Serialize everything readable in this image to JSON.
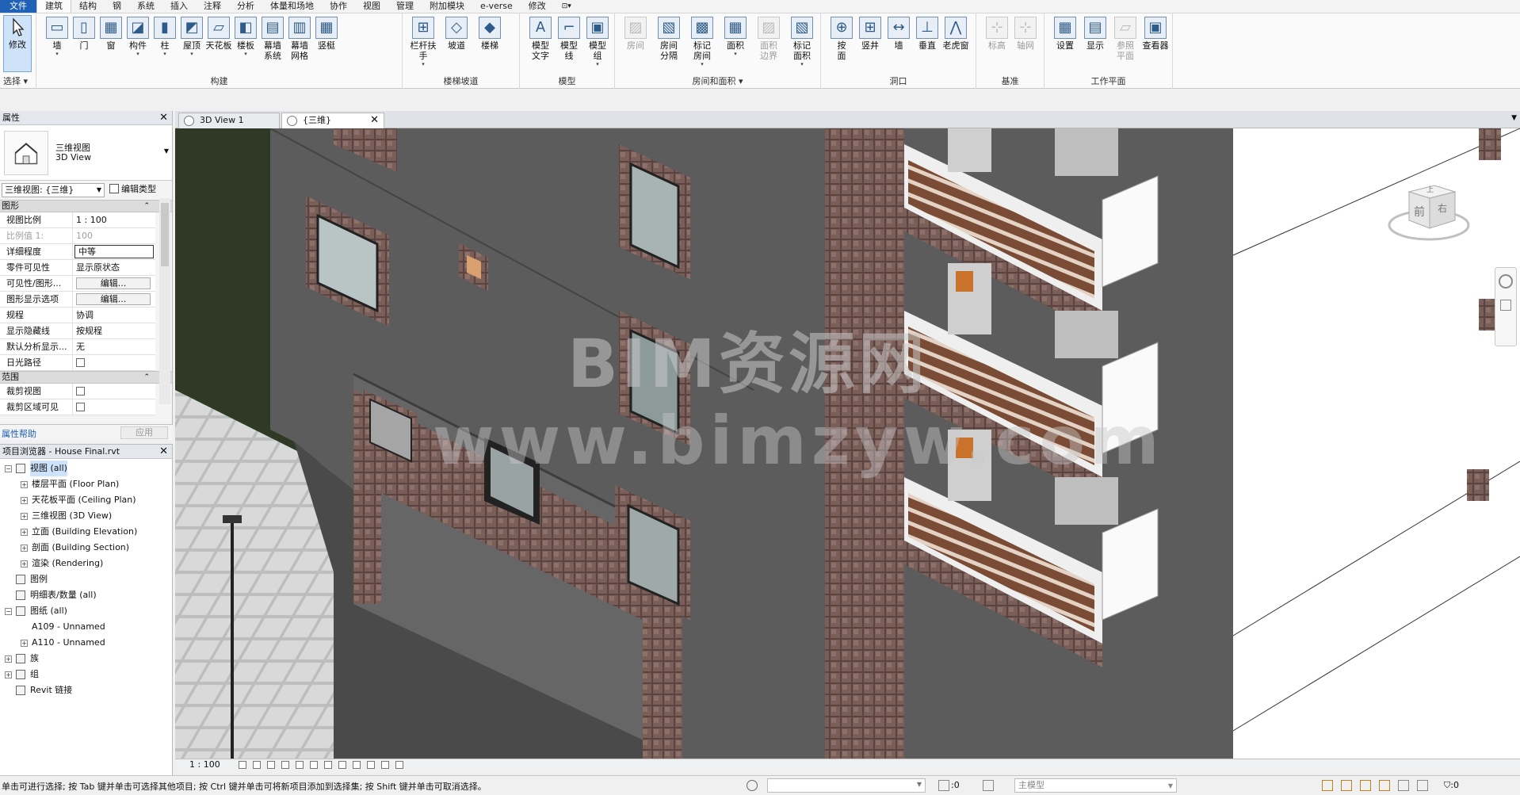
{
  "menu": {
    "tabs": [
      "文件",
      "建筑",
      "结构",
      "钢",
      "系统",
      "插入",
      "注释",
      "分析",
      "体量和场地",
      "协作",
      "视图",
      "管理",
      "附加模块",
      "e-verse",
      "修改"
    ],
    "active_index": 1
  },
  "ribbon": {
    "select": {
      "label": "修改",
      "title": "选择 ▾"
    },
    "build": {
      "title": "构建",
      "tools": [
        {
          "label": "墙",
          "dd": true
        },
        {
          "label": "门",
          "dd": false
        },
        {
          "label": "窗",
          "dd": false
        },
        {
          "label": "构件",
          "dd": true
        },
        {
          "label": "柱",
          "dd": true
        },
        {
          "label": "屋顶",
          "dd": true
        },
        {
          "label": "天花板",
          "dd": false
        },
        {
          "label": "楼板",
          "dd": true
        },
        {
          "label": "幕墙\n系统",
          "dd": false
        },
        {
          "label": "幕墙\n网格",
          "dd": false
        },
        {
          "label": "竖梃",
          "dd": false
        }
      ]
    },
    "stairs": {
      "title": "楼梯坡道",
      "tools": [
        {
          "label": "栏杆扶手",
          "dd": true
        },
        {
          "label": "坡道",
          "dd": false
        },
        {
          "label": "楼梯",
          "dd": false
        }
      ]
    },
    "model": {
      "title": "模型",
      "tools": [
        {
          "label": "模型\n文字",
          "dd": false
        },
        {
          "label": "模型\n线",
          "dd": false
        },
        {
          "label": "模型\n组",
          "dd": true
        }
      ]
    },
    "room": {
      "title": "房间和面积 ▾",
      "tools": [
        {
          "label": "房间",
          "dd": false,
          "dim": true
        },
        {
          "label": "房间\n分隔",
          "dd": false
        },
        {
          "label": "标记\n房间",
          "dd": true
        },
        {
          "label": "面积",
          "dd": true
        },
        {
          "label": "面积\n边界",
          "dd": false,
          "dim": true
        },
        {
          "label": "标记\n面积",
          "dd": true
        }
      ]
    },
    "opening": {
      "title": "洞口",
      "tools": [
        {
          "label": "按\n面",
          "dd": false
        },
        {
          "label": "竖井",
          "dd": false
        },
        {
          "label": "墙",
          "dd": false
        },
        {
          "label": "垂直",
          "dd": false
        },
        {
          "label": "老虎窗",
          "dd": false
        }
      ]
    },
    "datum": {
      "title": "基准",
      "tools": [
        {
          "label": "标高",
          "dd": false,
          "dim": true
        },
        {
          "label": "轴网",
          "dd": false,
          "dim": true
        }
      ]
    },
    "workplane": {
      "title": "工作平面",
      "tools": [
        {
          "label": "设置",
          "dd": false
        },
        {
          "label": "显示",
          "dd": false
        },
        {
          "label": "参照\n平面",
          "dd": false,
          "dim": true
        },
        {
          "label": "查看器",
          "dd": false
        }
      ]
    }
  },
  "properties": {
    "title": "属性",
    "type_name1": "三维视图",
    "type_name2": "3D View",
    "view_selector": "三维视图: {三维}",
    "edit_type": "编辑类型",
    "sections": {
      "graphics": "图形",
      "extents": "范围"
    },
    "rows": [
      {
        "k": "视图比例",
        "v": "1 : 100"
      },
      {
        "k": "比例值 1:",
        "v": "100",
        "dim": true
      },
      {
        "k": "详细程度",
        "v": "中等",
        "boxed": true
      },
      {
        "k": "零件可见性",
        "v": "显示原状态"
      },
      {
        "k": "可见性/图形...",
        "v": "编辑...",
        "btn": true
      },
      {
        "k": "图形显示选项",
        "v": "编辑...",
        "btn": true
      },
      {
        "k": "规程",
        "v": "协调"
      },
      {
        "k": "显示隐藏线",
        "v": "按规程"
      },
      {
        "k": "默认分析显示...",
        "v": "无"
      },
      {
        "k": "日光路径",
        "v": "",
        "chk": true
      }
    ],
    "extent_rows": [
      {
        "k": "裁剪视图",
        "v": "",
        "chk": true
      },
      {
        "k": "裁剪区域可见",
        "v": "",
        "chk": true
      }
    ],
    "help": "属性帮助",
    "apply": "应用"
  },
  "browser": {
    "title": "项目浏览器 - House Final.rvt",
    "nodes": [
      {
        "label": "视图 (all)",
        "level": 0,
        "exp": "−",
        "icon": true,
        "sel": true
      },
      {
        "label": "楼层平面 (Floor Plan)",
        "level": 1,
        "exp": "+"
      },
      {
        "label": "天花板平面 (Ceiling Plan)",
        "level": 1,
        "exp": "+"
      },
      {
        "label": "三维视图 (3D View)",
        "level": 1,
        "exp": "+"
      },
      {
        "label": "立面 (Building Elevation)",
        "level": 1,
        "exp": "+"
      },
      {
        "label": "剖面 (Building Section)",
        "level": 1,
        "exp": "+"
      },
      {
        "label": "渲染 (Rendering)",
        "level": 1,
        "exp": "+"
      },
      {
        "label": "图例",
        "level": 0,
        "exp": "",
        "icon": true
      },
      {
        "label": "明细表/数量 (all)",
        "level": 0,
        "exp": "",
        "icon": true
      },
      {
        "label": "图纸 (all)",
        "level": 0,
        "exp": "−",
        "icon": true
      },
      {
        "label": "A109 - Unnamed",
        "level": 1,
        "exp": ""
      },
      {
        "label": "A110 - Unnamed",
        "level": 1,
        "exp": "+"
      },
      {
        "label": "族",
        "level": 0,
        "exp": "+",
        "icon": true
      },
      {
        "label": "组",
        "level": 0,
        "exp": "+",
        "icon": true
      },
      {
        "label": "Revit 链接",
        "level": 0,
        "exp": "",
        "icon": true
      }
    ]
  },
  "viewtabs": [
    {
      "label": "3D View 1",
      "active": false
    },
    {
      "label": "{三维}",
      "active": true
    }
  ],
  "canvas": {
    "watermark1": "BIM资源网",
    "watermark2": "www.bimzyw.com",
    "viewcube_front": "前",
    "viewcube_right": "右",
    "viewcube_top": "上"
  },
  "view_control": {
    "scale": "1 : 100"
  },
  "status": {
    "message": "单击可进行选择; 按 Tab 键并单击可选择其他项目; 按 Ctrl 键并单击可将新项目添加到选择集; 按 Shift 键并单击可取消选择。",
    "zero": ":0",
    "model": "主模型",
    "filter": ":0"
  }
}
